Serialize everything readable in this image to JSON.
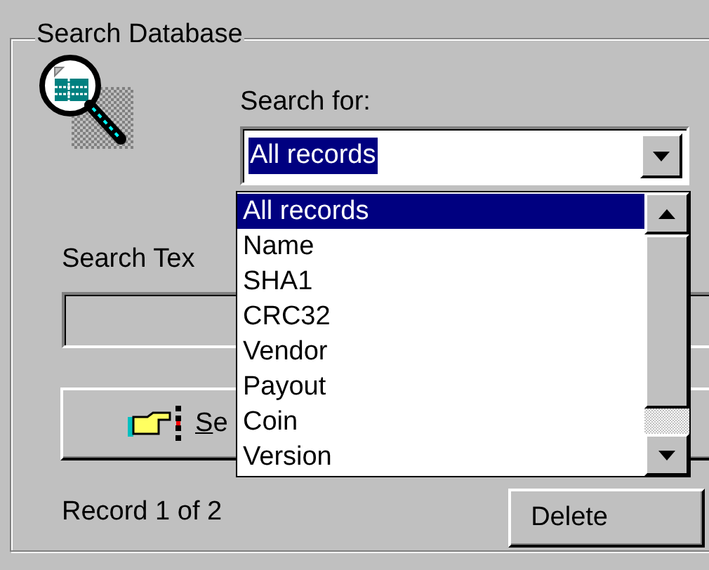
{
  "group": {
    "title": "Search Database"
  },
  "search_for": {
    "label": "Search for:",
    "value": "All records",
    "dropdown_items": [
      {
        "label": "All records",
        "selected": true
      },
      {
        "label": "Name",
        "selected": false
      },
      {
        "label": "SHA1",
        "selected": false
      },
      {
        "label": "CRC32",
        "selected": false
      },
      {
        "label": "Vendor",
        "selected": false
      },
      {
        "label": "Payout",
        "selected": false
      },
      {
        "label": "Coin",
        "selected": false
      },
      {
        "label": "Version",
        "selected": false
      }
    ]
  },
  "search_text": {
    "label": "Search Tex"
  },
  "search_button": {
    "label": "Se"
  },
  "record_status": "Record 1 of 2",
  "delete_button": {
    "label": "Delete"
  }
}
